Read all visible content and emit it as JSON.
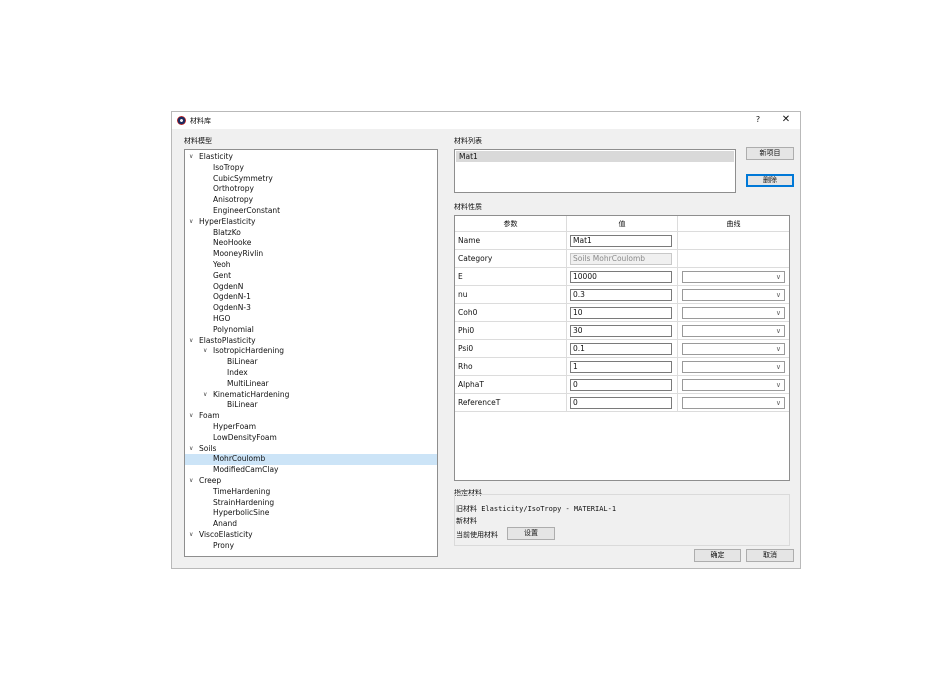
{
  "window": {
    "title": "材料库",
    "help_label": "?",
    "close_label": "✕"
  },
  "model_tree": {
    "label": "材料模型",
    "items": [
      {
        "label": "Elasticity",
        "level": 0,
        "expanded": true
      },
      {
        "label": "IsoTropy",
        "level": 1
      },
      {
        "label": "CubicSymmetry",
        "level": 1
      },
      {
        "label": "Orthotropy",
        "level": 1
      },
      {
        "label": "Anisotropy",
        "level": 1
      },
      {
        "label": "EngineerConstant",
        "level": 1
      },
      {
        "label": "HyperElasticity",
        "level": 0,
        "expanded": true
      },
      {
        "label": "BlatzKo",
        "level": 1
      },
      {
        "label": "NeoHooke",
        "level": 1
      },
      {
        "label": "MooneyRivlin",
        "level": 1
      },
      {
        "label": "Yeoh",
        "level": 1
      },
      {
        "label": "Gent",
        "level": 1
      },
      {
        "label": "OgdenN",
        "level": 1
      },
      {
        "label": "OgdenN-1",
        "level": 1
      },
      {
        "label": "OgdenN-3",
        "level": 1
      },
      {
        "label": "HGO",
        "level": 1
      },
      {
        "label": "Polynomial",
        "level": 1
      },
      {
        "label": "ElastoPlasticity",
        "level": 0,
        "expanded": true
      },
      {
        "label": "IsotropicHardening",
        "level": 1,
        "expanded": true
      },
      {
        "label": "BiLinear",
        "level": 2
      },
      {
        "label": "Index",
        "level": 2
      },
      {
        "label": "MultiLinear",
        "level": 2
      },
      {
        "label": "KinematicHardening",
        "level": 1,
        "expanded": true
      },
      {
        "label": "BiLinear",
        "level": 2
      },
      {
        "label": "Foam",
        "level": 0,
        "expanded": true
      },
      {
        "label": "HyperFoam",
        "level": 1
      },
      {
        "label": "LowDensityFoam",
        "level": 1
      },
      {
        "label": "Soils",
        "level": 0,
        "expanded": true
      },
      {
        "label": "MohrCoulomb",
        "level": 1,
        "selected": true
      },
      {
        "label": "ModifiedCamClay",
        "level": 1
      },
      {
        "label": "Creep",
        "level": 0,
        "expanded": true
      },
      {
        "label": "TimeHardening",
        "level": 1
      },
      {
        "label": "StrainHardening",
        "level": 1
      },
      {
        "label": "HyperbolicSine",
        "level": 1
      },
      {
        "label": "Anand",
        "level": 1
      },
      {
        "label": "ViscoElasticity",
        "level": 0,
        "expanded": true
      },
      {
        "label": "Prony",
        "level": 1
      }
    ]
  },
  "material_list": {
    "label": "材料列表",
    "items": [
      "Mat1"
    ],
    "new_button": "新项目",
    "delete_button": "删除"
  },
  "properties": {
    "label": "材料性质",
    "headers": {
      "param": "参数",
      "value": "值",
      "curve": "曲线"
    },
    "rows": [
      {
        "name": "Name",
        "value": "Mat1",
        "has_curve": false
      },
      {
        "name": "Category",
        "value": "Soils MohrCoulomb",
        "has_curve": false,
        "readonly": true
      },
      {
        "name": "E",
        "value": "10000",
        "has_curve": true
      },
      {
        "name": "nu",
        "value": "0.3",
        "has_curve": true
      },
      {
        "name": "Coh0",
        "value": "10",
        "has_curve": true
      },
      {
        "name": "Phi0",
        "value": "30",
        "has_curve": true
      },
      {
        "name": "Psi0",
        "value": "0.1",
        "has_curve": true
      },
      {
        "name": "Rho",
        "value": "1",
        "has_curve": true
      },
      {
        "name": "AlphaT",
        "value": "0",
        "has_curve": true
      },
      {
        "name": "ReferenceT",
        "value": "0",
        "has_curve": true
      }
    ]
  },
  "assign": {
    "label": "指定材料",
    "old_material": "旧材料 Elasticity/IsoTropy - MATERIAL-1",
    "new_material": "新材料",
    "current_label": "当前使用材料",
    "set_button": "设置"
  },
  "footer": {
    "ok_button": "确定",
    "cancel_button": "取消"
  }
}
